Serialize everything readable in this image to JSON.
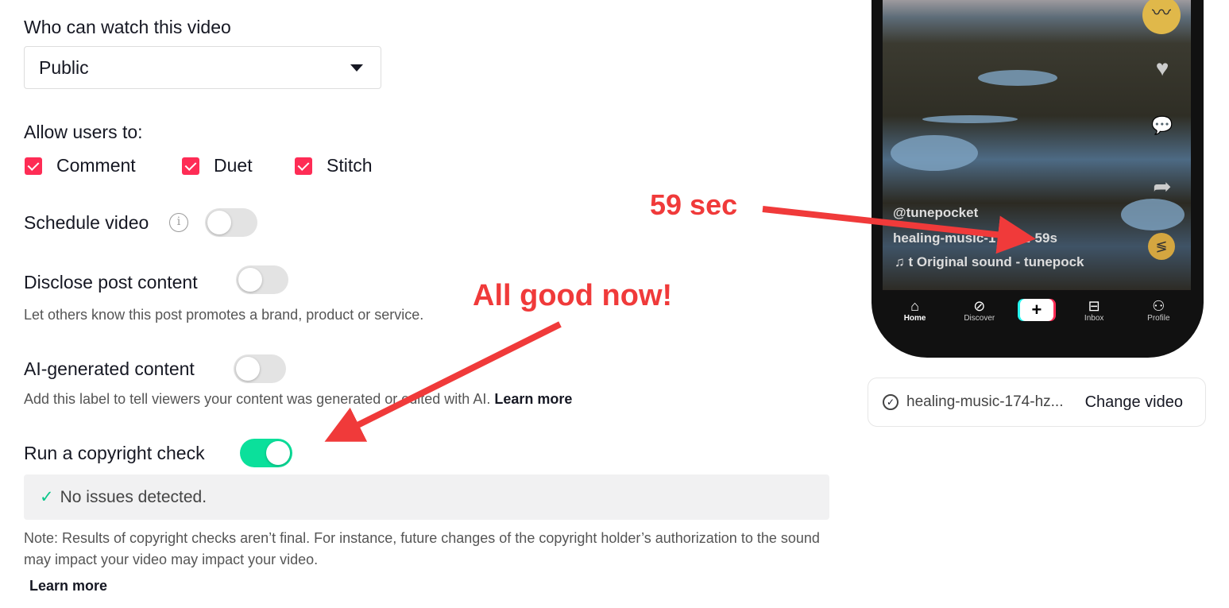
{
  "privacy": {
    "label": "Who can watch this video",
    "value": "Public"
  },
  "allow": {
    "label": "Allow users to:",
    "options": [
      {
        "label": "Comment",
        "checked": true
      },
      {
        "label": "Duet",
        "checked": true
      },
      {
        "label": "Stitch",
        "checked": true
      }
    ]
  },
  "schedule": {
    "label": "Schedule video",
    "info_icon": "i",
    "on": false
  },
  "disclose": {
    "label": "Disclose post content",
    "desc": "Let others know this post promotes a brand, product or service.",
    "on": false
  },
  "ai": {
    "label": "AI-generated content",
    "desc": "Add this label to tell viewers your content was generated or edited with AI.",
    "learn_more": "Learn more",
    "on": false
  },
  "copyright": {
    "label": "Run a copyright check",
    "on": true,
    "result": "No issues detected.",
    "note": "Note: Results of copyright checks aren’t final. For instance, future changes of the copyright holder’s authorization to the sound may impact your video may impact your video.",
    "learn_more": "Learn more"
  },
  "preview": {
    "username": "@tunepocket",
    "caption": "healing-music-174-hz-59s",
    "sound": "t Original sound - tunepock",
    "nav": [
      "Home",
      "Discover",
      "Inbox",
      "Profile"
    ]
  },
  "file": {
    "name": "healing-music-174-hz...",
    "change": "Change video"
  },
  "annotations": {
    "duration": "59 sec",
    "status": "All good now!",
    "color": "#f03a3a"
  },
  "colors": {
    "accent": "#fe2c55",
    "toggle_on": "#0be09b"
  }
}
